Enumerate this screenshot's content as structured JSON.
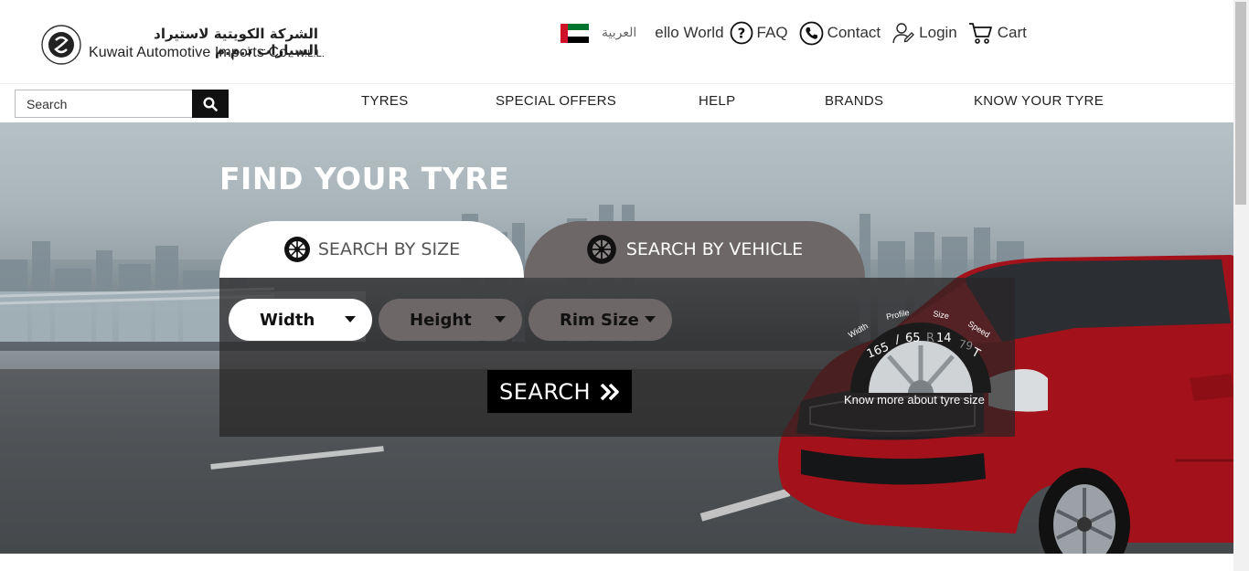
{
  "brand": {
    "name_ar": "الشركة الكويتية لاستيراد السيارات ذ.م.م",
    "name_en": "Kuwait Automotive Imports Co.",
    "name_suffix": "W.L.L.",
    "emblem_icon": "company-emblem-icon"
  },
  "topbar": {
    "language_label": "العربية",
    "greeting": "ello World",
    "faq_label": "FAQ",
    "contact_label": "Contact",
    "login_label": "Login",
    "cart_label": "Cart"
  },
  "search": {
    "placeholder": "Search"
  },
  "nav": {
    "items": [
      {
        "label": "TYRES"
      },
      {
        "label": "SPECIAL OFFERS"
      },
      {
        "label": "HELP"
      },
      {
        "label": "BRANDS"
      },
      {
        "label": "KNOW YOUR TYRE"
      }
    ]
  },
  "hero": {
    "title": "FIND YOUR TYRE",
    "tabs": [
      {
        "label": "SEARCH BY SIZE",
        "active": true
      },
      {
        "label": "SEARCH BY VEHICLE",
        "active": false
      }
    ],
    "selects": {
      "width": "Width",
      "height": "Height",
      "rim": "Rim Size"
    },
    "search_button": "SEARCH",
    "tyre_info": {
      "arc_labels": [
        "Width",
        "Profile",
        "Size",
        "Speed"
      ],
      "code_parts": [
        "165",
        "/",
        "65",
        "R",
        "14",
        "79",
        "T"
      ],
      "link_text": "Know more about tyre size"
    }
  },
  "colors": {
    "accent_dark": "#000000",
    "tab_inactive": "#6d6767",
    "car_red": "#b3121b"
  }
}
